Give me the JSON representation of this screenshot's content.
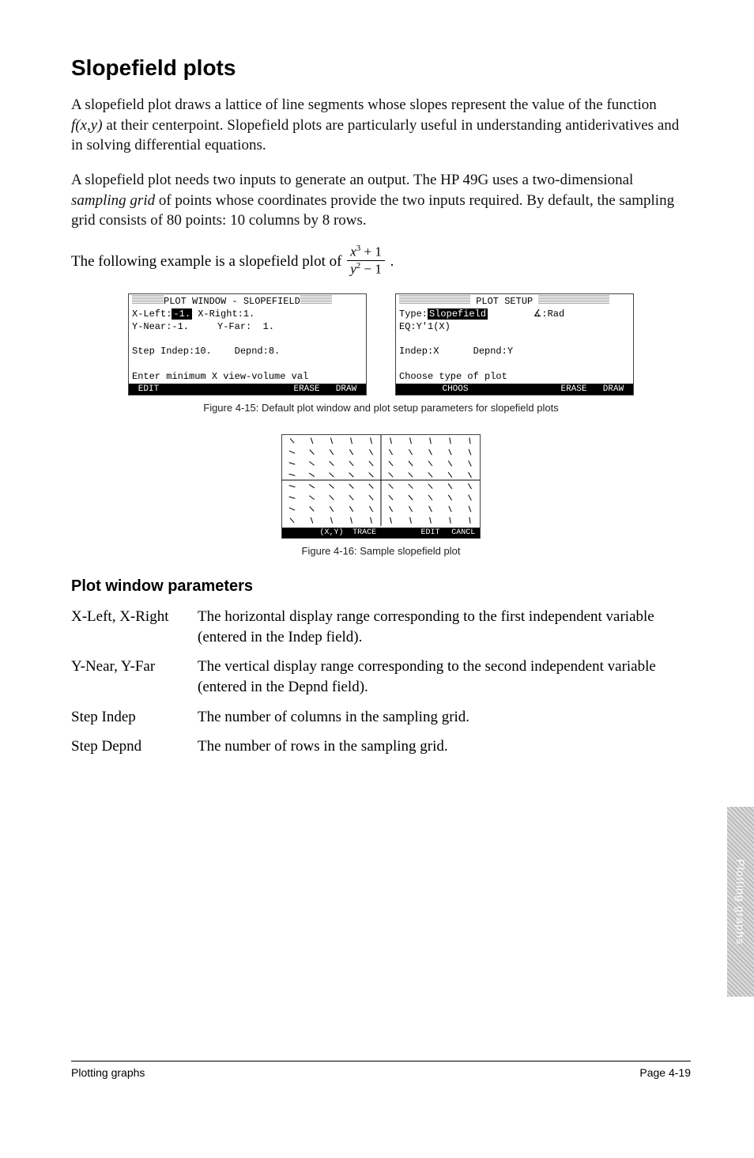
{
  "title": "Slopefield plots",
  "para1": "A slopefield plot draws a lattice of line segments whose slopes represent the value of the function f(x,y) at their centerpoint. Slopefield plots are particularly useful in understanding antiderivatives and in solving differential equations.",
  "para2": "A slopefield plot needs two inputs to generate an output. The HP 49G uses a two-dimensional sampling grid of points whose coordinates provide the two inputs required. By default, the sampling grid consists of 80 points: 10 columns by 8 rows.",
  "formula_lead": "The following example is a slopefield plot of ",
  "formula_num": "x³ + 1",
  "formula_den": "y² − 1",
  "screen_left": {
    "title": "PLOT WINDOW - SLOPEFIELD",
    "l1a": "X-Left:",
    "l1a_val": "-1.",
    "l1b": " X-Right:1.",
    "l2": "Y-Near:-1.     Y-Far:  1.",
    "l3": "Step Indep:10.    Depnd:8.",
    "prompt": "Enter minimum X view-volume val",
    "menu": [
      "EDIT",
      "",
      "",
      "",
      "ERASE",
      "DRAW"
    ]
  },
  "screen_right": {
    "title": "PLOT SETUP",
    "l1a": "Type:",
    "l1a_val": "Slopefield",
    "l1b": "∡:Rad",
    "l2": "EQ:Y'1(X)",
    "l3": "Indep:X      Depnd:Y",
    "prompt": "Choose type of plot",
    "menu": [
      "",
      "CHOOS",
      "",
      "",
      "ERASE",
      "DRAW"
    ]
  },
  "figcap1": "Figure 4-15: Default plot window and plot setup parameters for slopefield plots",
  "plot_menu": [
    "",
    "(X,Y)",
    "TRACE",
    "",
    "EDIT",
    "CANCL"
  ],
  "figcap2": "Figure 4-16: Sample slopefield plot",
  "subhead": "Plot window parameters",
  "params": [
    {
      "label": "X-Left, X-Right",
      "desc": "The horizontal display range corresponding to the first independent variable (entered in the Indep field)."
    },
    {
      "label": "Y-Near, Y-Far",
      "desc": "The vertical display range corresponding to the second independent variable (entered in the Depnd field)."
    },
    {
      "label": "Step Indep",
      "desc": "The number of columns in the sampling grid."
    },
    {
      "label": "Step Depnd",
      "desc": "The number of rows in the sampling grid."
    }
  ],
  "footer_left": "Plotting graphs",
  "footer_right": "Page 4-19",
  "side_tab": "Plotting graphs",
  "chart_data": {
    "type": "slopefield",
    "equation": "(x^3 + 1) / (y^2 - 1)",
    "x_range": [
      -1,
      1
    ],
    "y_range": [
      -1,
      1
    ],
    "grid_cols": 10,
    "grid_rows": 8,
    "menu": [
      "",
      "(X,Y)",
      "TRACE",
      "",
      "EDIT",
      "CANCL"
    ]
  }
}
